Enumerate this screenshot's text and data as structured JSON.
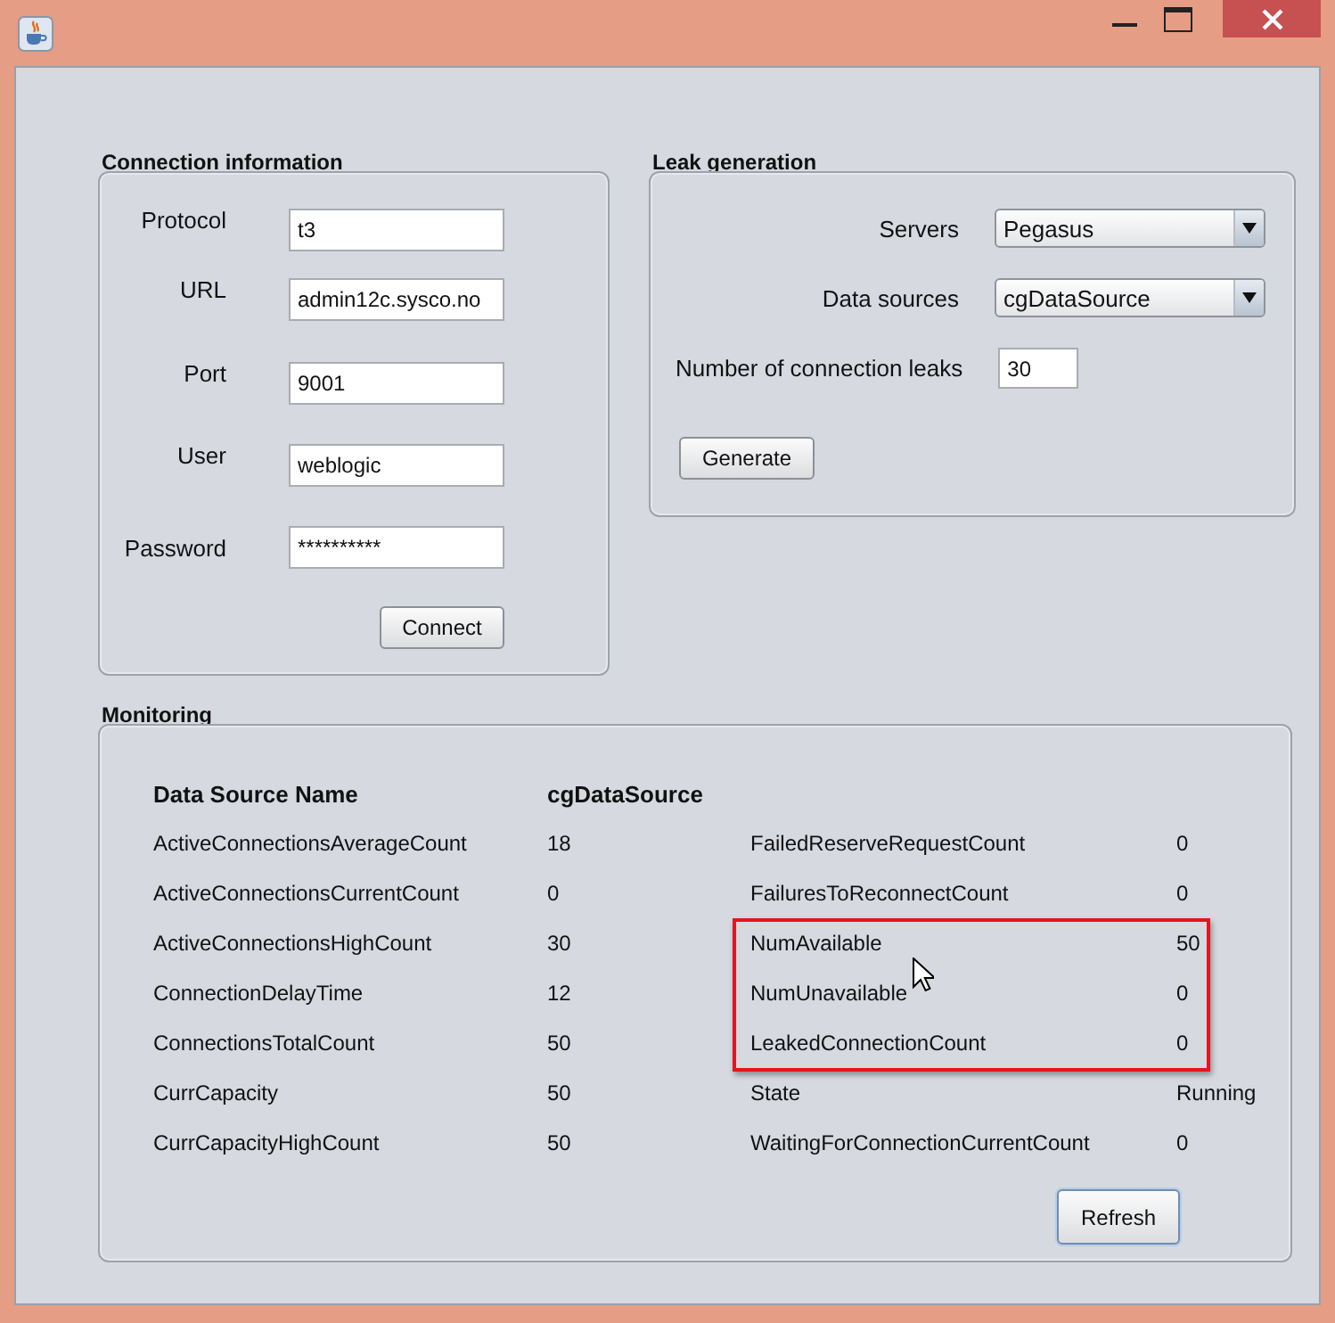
{
  "connection": {
    "title": "Connection information",
    "fields": [
      {
        "label": "Protocol",
        "value": "t3"
      },
      {
        "label": "URL",
        "value": "admin12c.sysco.no"
      },
      {
        "label": "Port",
        "value": "9001"
      },
      {
        "label": "User",
        "value": "weblogic"
      },
      {
        "label": "Password",
        "value": "**********"
      }
    ],
    "button": "Connect"
  },
  "leak": {
    "title": "Leak generation",
    "selects": [
      {
        "label": "Servers",
        "value": "Pegasus"
      },
      {
        "label": "Data sources",
        "value": "cgDataSource"
      }
    ],
    "leaks": {
      "label": "Number of connection leaks",
      "value": "30"
    },
    "button": "Generate"
  },
  "monitoring": {
    "title": "Monitoring",
    "header": [
      "Data Source Name",
      "cgDataSource"
    ],
    "stats_left": [
      {
        "name": "ActiveConnectionsAverageCount",
        "value": "18"
      },
      {
        "name": "ActiveConnectionsCurrentCount",
        "value": "0"
      },
      {
        "name": "ActiveConnectionsHighCount",
        "value": "30"
      },
      {
        "name": "ConnectionDelayTime",
        "value": "12"
      },
      {
        "name": "ConnectionsTotalCount",
        "value": "50"
      },
      {
        "name": "CurrCapacity",
        "value": "50"
      },
      {
        "name": "CurrCapacityHighCount",
        "value": "50"
      }
    ],
    "stats_right": [
      {
        "name": "FailedReserveRequestCount",
        "value": "0",
        "highlighted": false
      },
      {
        "name": "FailuresToReconnectCount",
        "value": "0",
        "highlighted": false
      },
      {
        "name": "NumAvailable",
        "value": "50",
        "highlighted": true
      },
      {
        "name": "NumUnavailable",
        "value": "0",
        "highlighted": true
      },
      {
        "name": "LeakedConnectionCount",
        "value": "0",
        "highlighted": true
      },
      {
        "name": "State",
        "value": "Running",
        "highlighted": false
      },
      {
        "name": "WaitingForConnectionCurrentCount",
        "value": "0",
        "highlighted": false
      }
    ],
    "button": "Refresh"
  }
}
